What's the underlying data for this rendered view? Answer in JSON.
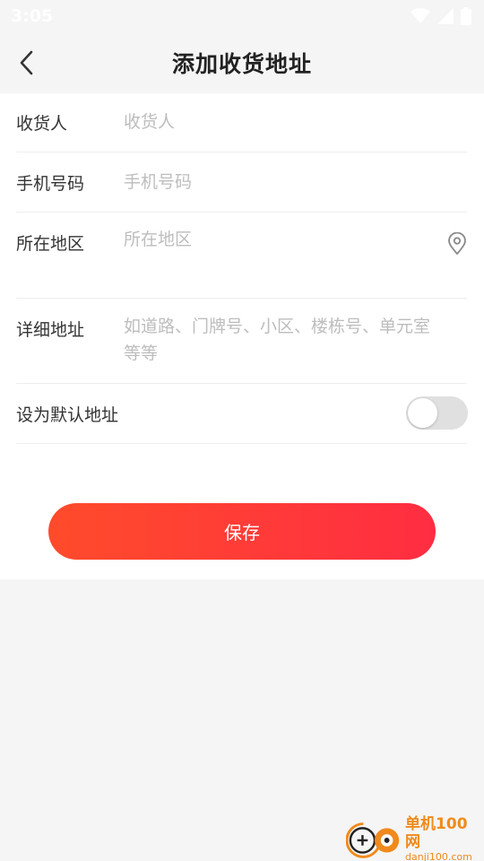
{
  "status_bar": {
    "time": "3:05"
  },
  "nav": {
    "title": "添加收货地址"
  },
  "form": {
    "recipient": {
      "label": "收货人",
      "placeholder": "收货人"
    },
    "phone": {
      "label": "手机号码",
      "placeholder": "手机号码"
    },
    "region": {
      "label": "所在地区",
      "placeholder": "所在地区"
    },
    "detail": {
      "label": "详细地址",
      "placeholder": "如道路、门牌号、小区、楼栋号、单元室等等"
    },
    "default": {
      "label": "设为默认地址",
      "enabled": false
    }
  },
  "actions": {
    "save_label": "保存"
  },
  "colors": {
    "accent_start": "#ff4b2b",
    "accent_end": "#ff2d42",
    "watermark": "#f08a1c"
  },
  "watermark": {
    "title": "单机100网",
    "url": "danji100.com"
  }
}
